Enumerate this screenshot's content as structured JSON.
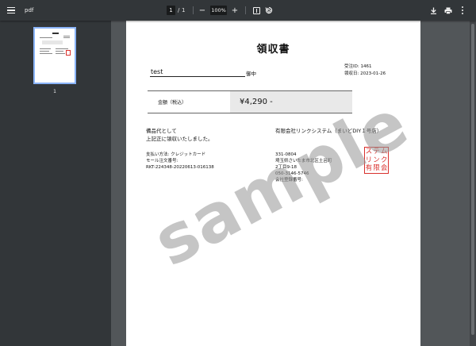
{
  "toolbar": {
    "title": "pdf",
    "current_page": "1",
    "page_separator": "/",
    "total_pages": "1",
    "zoom_out": "−",
    "zoom": "100%",
    "zoom_in": "+"
  },
  "sidebar": {
    "thumbnail_label": "1"
  },
  "receipt": {
    "title": "領収書",
    "addressee": "test",
    "honorific": "御中",
    "order_id": "受注ID: 1461",
    "issue_date": "領収日: 2023-01-26",
    "amount_label": "金額（税込）",
    "amount_value": "¥4,290 -",
    "purpose_line1": "備品代として",
    "purpose_line2": "上記正に領収いたしました。",
    "payment_method": "支払い方法: クレジットカード",
    "mall_order_label": "モール注文番号:",
    "mall_order_number": "RKT-224348-20220613-016138",
    "issuer_name": "有限会社リンクシステム（まいどDIY１号店）",
    "postal_code": "331-0804",
    "address": "埼玉県さいたま市北区土呂町",
    "address2": "2丁目9-18",
    "phone": "050-3146-5746",
    "registration_label": "会社登録番号:",
    "seal_chars": [
      "ス",
      "テ",
      "ム",
      "リ",
      "ン",
      "ク",
      "有",
      "限",
      "会",
      "社",
      "印",
      "シ"
    ],
    "watermark": "sample"
  },
  "colors": {
    "toolbar_bg": "#323639",
    "viewer_bg": "#525659",
    "thumb_border": "#8ab4f8",
    "seal_red": "#d9302c"
  },
  "icons": [
    "menu-icon",
    "zoom-out-icon",
    "zoom-in-icon",
    "fit-page-icon",
    "rotate-icon",
    "download-icon",
    "print-icon",
    "more-options-icon"
  ]
}
